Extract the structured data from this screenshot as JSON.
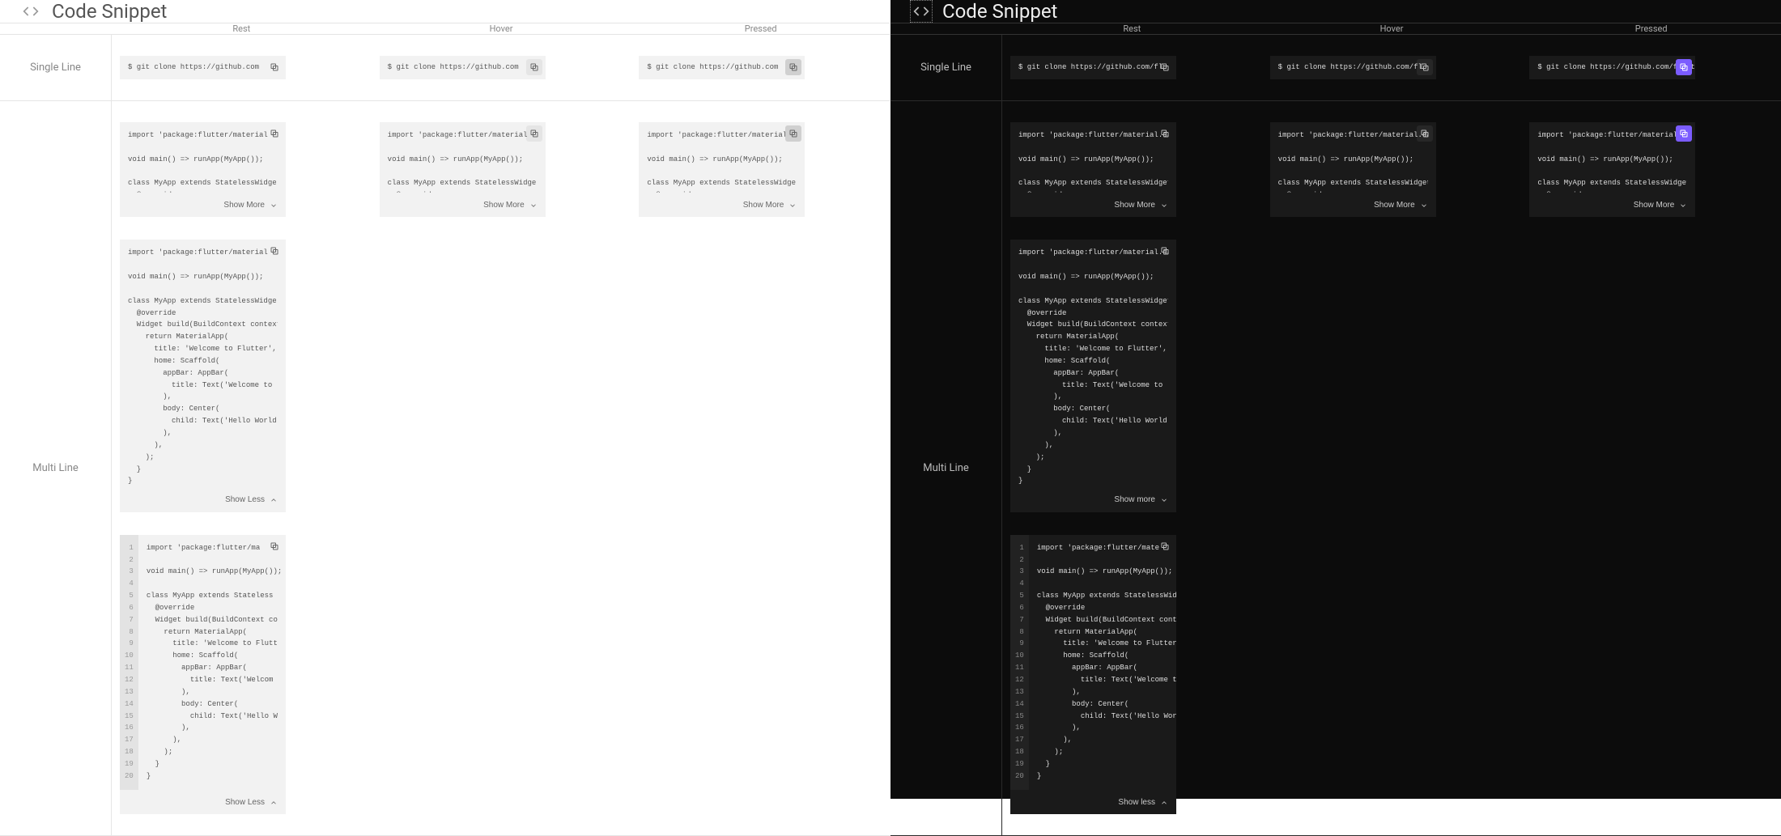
{
  "header": {
    "title": "Code Snippet"
  },
  "states": {
    "rest": "Rest",
    "hover": "Hover",
    "pressed": "Pressed"
  },
  "rows": {
    "single": "Single Line",
    "multi": "Multi Line"
  },
  "toggles": {
    "show_more": "Show More",
    "show_less": "Show Less",
    "show_more_lc": "Show more",
    "show_less_lc": "Show less"
  },
  "single": {
    "light": "$ git clone https://github.com",
    "dark_rest": "$ git clone https://github.com/flu",
    "dark_hover": "$ git clone https://github.com/fl",
    "dark_pressed": "$ git clone https://github.com/flutte"
  },
  "multi_collapsed": {
    "light": "import 'package:flutter/material\n\nvoid main() => runApp(MyApp());\n\nclass MyApp extends StatelessWidge\n  @override\n  Widget build(BuildContext context\n    return MaterialApp(",
    "dark": "import 'package:flutter/material.dart';\n\nvoid main() => runApp(MyApp());\n\nclass MyApp extends StatelessWidget {\n  @override\n  Widget build(BuildContext context) {\n    return MaterialApp("
  },
  "multi_expanded": {
    "light": "import 'package:flutter/material\n\nvoid main() => runApp(MyApp());\n\nclass MyApp extends StatelessWidge\n  @override\n  Widget build(BuildContext context\n    return MaterialApp(\n      title: 'Welcome to Flutter',\n      home: Scaffold(\n        appBar: AppBar(\n          title: Text('Welcome to\n        ),\n        body: Center(\n          child: Text('Hello World\n        ),\n      ),\n    );\n  }\n}",
    "dark": "import 'package:flutter/material.dart';\n\nvoid main() => runApp(MyApp());\n\nclass MyApp extends StatelessWidget {\n  @override\n  Widget build(BuildContext context) {\n    return MaterialApp(\n      title: 'Welcome to Flutter',\n      home: Scaffold(\n        appBar: AppBar(\n          title: Text('Welcome to\n        ),\n        body: Center(\n          child: Text('Hello World'),\n        ),\n      ),\n    );\n  }\n}"
  },
  "lined": {
    "numbers": "1\n2\n3\n4\n5\n6\n7\n8\n9\n10\n11\n12\n13\n14\n15\n16\n17\n18\n19\n20",
    "light": "import 'package:flutter/ma\n\nvoid main() => runApp(MyApp());\n\nclass MyApp extends Stateless\n  @override\n  Widget build(BuildContext co\n    return MaterialApp(\n      title: 'Welcome to Flutt\n      home: Scaffold(\n        appBar: AppBar(\n          title: Text('Welcom\n        ),\n        body: Center(\n          child: Text('Hello W\n        ),\n      ),\n    );\n  }\n}",
    "dark": "import 'package:flutter/mate\n\nvoid main() => runApp(MyApp());\n\nclass MyApp extends StatelessWidg\n  @override\n  Widget build(BuildContext contex\n    return MaterialApp(\n      title: 'Welcome to Flutter',\n      home: Scaffold(\n        appBar: AppBar(\n          title: Text('Welcome to\n        ),\n        body: Center(\n          child: Text('Hello Worl\n        ),\n      ),\n    );\n  }\n}"
  }
}
